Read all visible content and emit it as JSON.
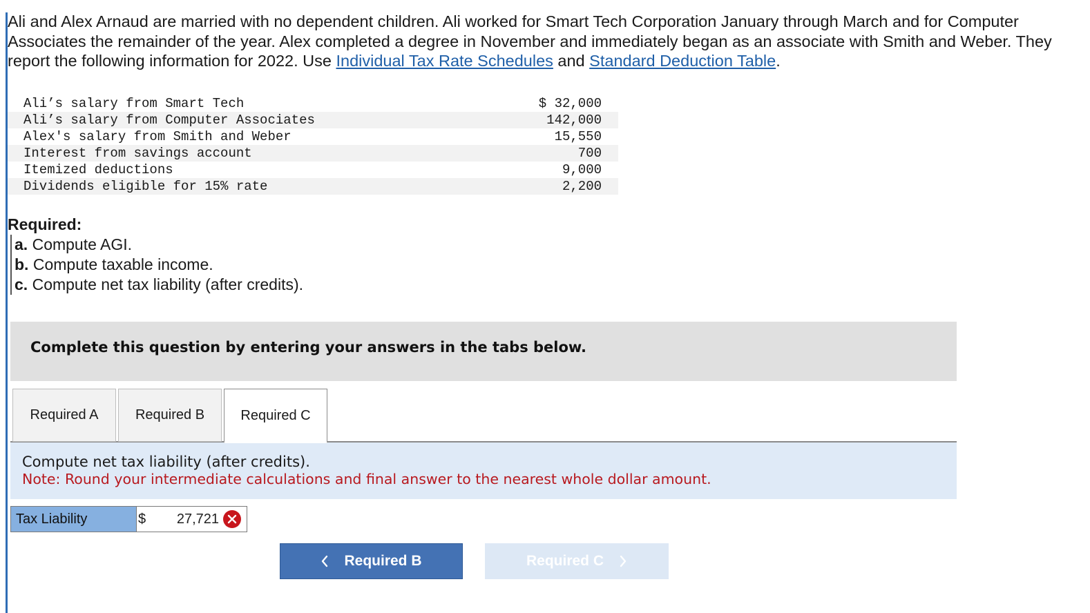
{
  "intro": {
    "text_before_links": "Ali and Alex Arnaud are married with no dependent children. Ali worked for Smart Tech Corporation January through March and for Computer Associates the remainder of the year. Alex completed a degree in November and immediately began as an associate with Smith and Weber. They report the following information for 2022. Use ",
    "link1": "Individual Tax Rate Schedules",
    "between_links": " and ",
    "link2": "Standard Deduction Table",
    "after_links": "."
  },
  "data_table": {
    "rows": [
      {
        "label": "Ali’s salary from Smart Tech",
        "value": "$ 32,000"
      },
      {
        "label": "Ali’s salary from Computer Associates",
        "value": "142,000"
      },
      {
        "label": "Alex's salary from Smith and Weber",
        "value": "15,550"
      },
      {
        "label": "Interest from savings account",
        "value": "700"
      },
      {
        "label": "Itemized deductions",
        "value": "9,000"
      },
      {
        "label": "Dividends eligible for 15% rate",
        "value": "2,200"
      }
    ]
  },
  "required": {
    "title": "Required:",
    "items": [
      {
        "letter": "a.",
        "text": "Compute AGI."
      },
      {
        "letter": "b.",
        "text": "Compute taxable income."
      },
      {
        "letter": "c.",
        "text": "Compute net tax liability (after credits)."
      }
    ]
  },
  "banner": {
    "text": "Complete this question by entering your answers in the tabs below."
  },
  "tabs": [
    {
      "label": "Required A"
    },
    {
      "label": "Required B"
    },
    {
      "label": "Required C"
    }
  ],
  "active_tab": "Required C",
  "info": {
    "instruction": "Compute net tax liability (after credits).",
    "note": "Note: Round your intermediate calculations and final answer to the nearest whole dollar amount."
  },
  "answer": {
    "label": "Tax Liability",
    "currency": "$",
    "value": "27,721",
    "status": "incorrect"
  },
  "nav": {
    "prev_label": "Required B",
    "next_label": "Required C"
  },
  "colors": {
    "accent": "#4472b4",
    "link": "#1f5fa8",
    "error": "#c8161d",
    "note": "#b8191f",
    "info_bg": "#dfeaf7",
    "label_bg": "#86b0e0"
  }
}
